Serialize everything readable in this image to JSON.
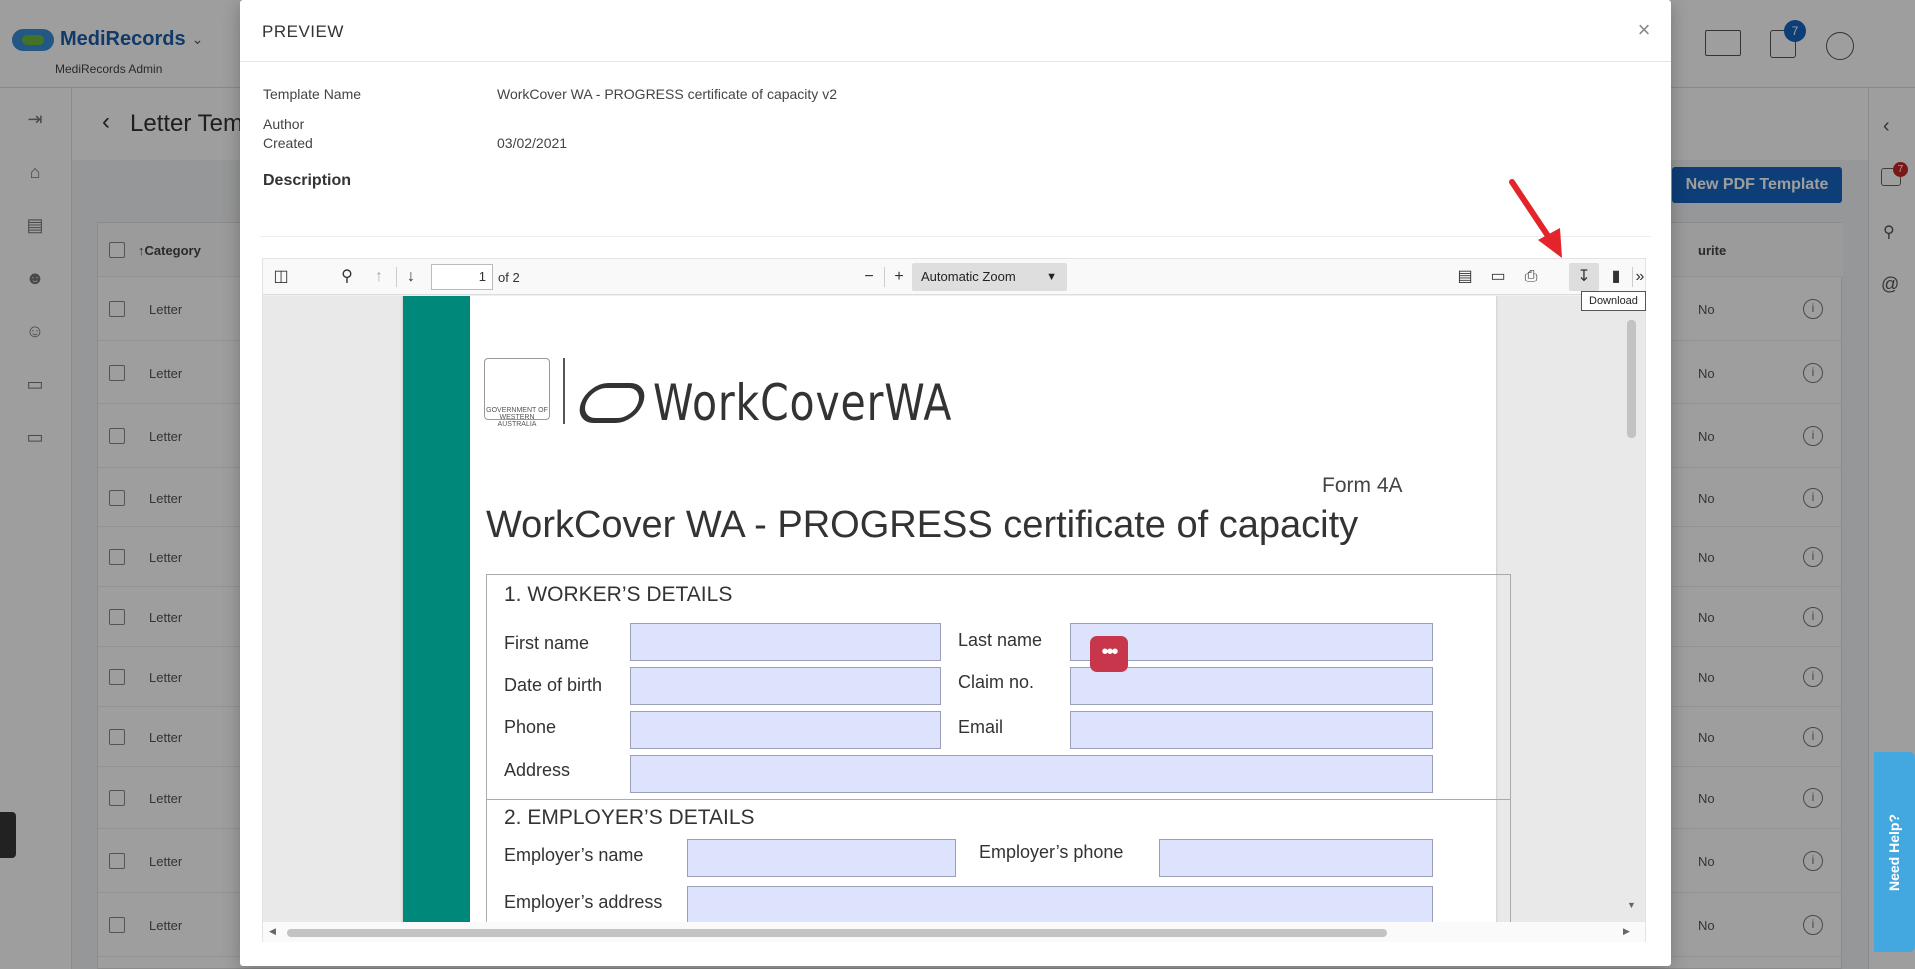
{
  "app": {
    "brand": "MediRecords",
    "admin_label": "MediRecords Admin",
    "notif_count": "7",
    "side_badge": "7"
  },
  "page": {
    "title": "Letter Tem",
    "new_button": "New PDF Template"
  },
  "table": {
    "headers": {
      "category": "Category",
      "favourite": "urite"
    },
    "rows": [
      {
        "category": "Letter",
        "favourite": "No"
      },
      {
        "category": "Letter",
        "favourite": "No"
      },
      {
        "category": "Letter",
        "favourite": "No"
      },
      {
        "category": "Letter",
        "favourite": "No"
      },
      {
        "category": "Letter",
        "favourite": "No"
      },
      {
        "category": "Letter",
        "favourite": "No"
      },
      {
        "category": "Letter",
        "favourite": "No"
      },
      {
        "category": "Letter",
        "favourite": "No"
      },
      {
        "category": "Letter",
        "favourite": "No"
      },
      {
        "category": "Letter",
        "favourite": "No"
      },
      {
        "category": "Letter",
        "favourite": "No"
      }
    ]
  },
  "modal": {
    "title": "PREVIEW",
    "template_name_label": "Template Name",
    "template_name": "WorkCover WA - PROGRESS certificate of capacity v2",
    "author_label": "Author",
    "author": "",
    "created_label": "Created",
    "created": "03/02/2021",
    "description_label": "Description"
  },
  "viewer": {
    "page_number": "1",
    "page_of": "of 2",
    "zoom": "Automatic Zoom",
    "tooltip": "Download"
  },
  "pdf": {
    "crest_text": "GOVERNMENT OF WESTERN AUSTRALIA",
    "logo_text": "WorkCoverWA",
    "form_no": "Form 4A",
    "title": "WorkCover WA - PROGRESS certificate of capacity",
    "section1": "1. WORKER’S DETAILS",
    "first_name": "First name",
    "last_name": "Last name",
    "dob": "Date of birth",
    "claim_no": "Claim no.",
    "phone": "Phone",
    "email": "Email",
    "address": "Address",
    "section2": "2. EMPLOYER’S DETAILS",
    "employer_name": "Employer’s name",
    "employer_phone": "Employer’s phone",
    "employer_address": "Employer’s address"
  },
  "help": {
    "label": "Need Help?"
  },
  "colors": {
    "accent": "#1565c0",
    "green": "#00897b",
    "field": "#dde3fc",
    "arrow": "#e3242b"
  }
}
